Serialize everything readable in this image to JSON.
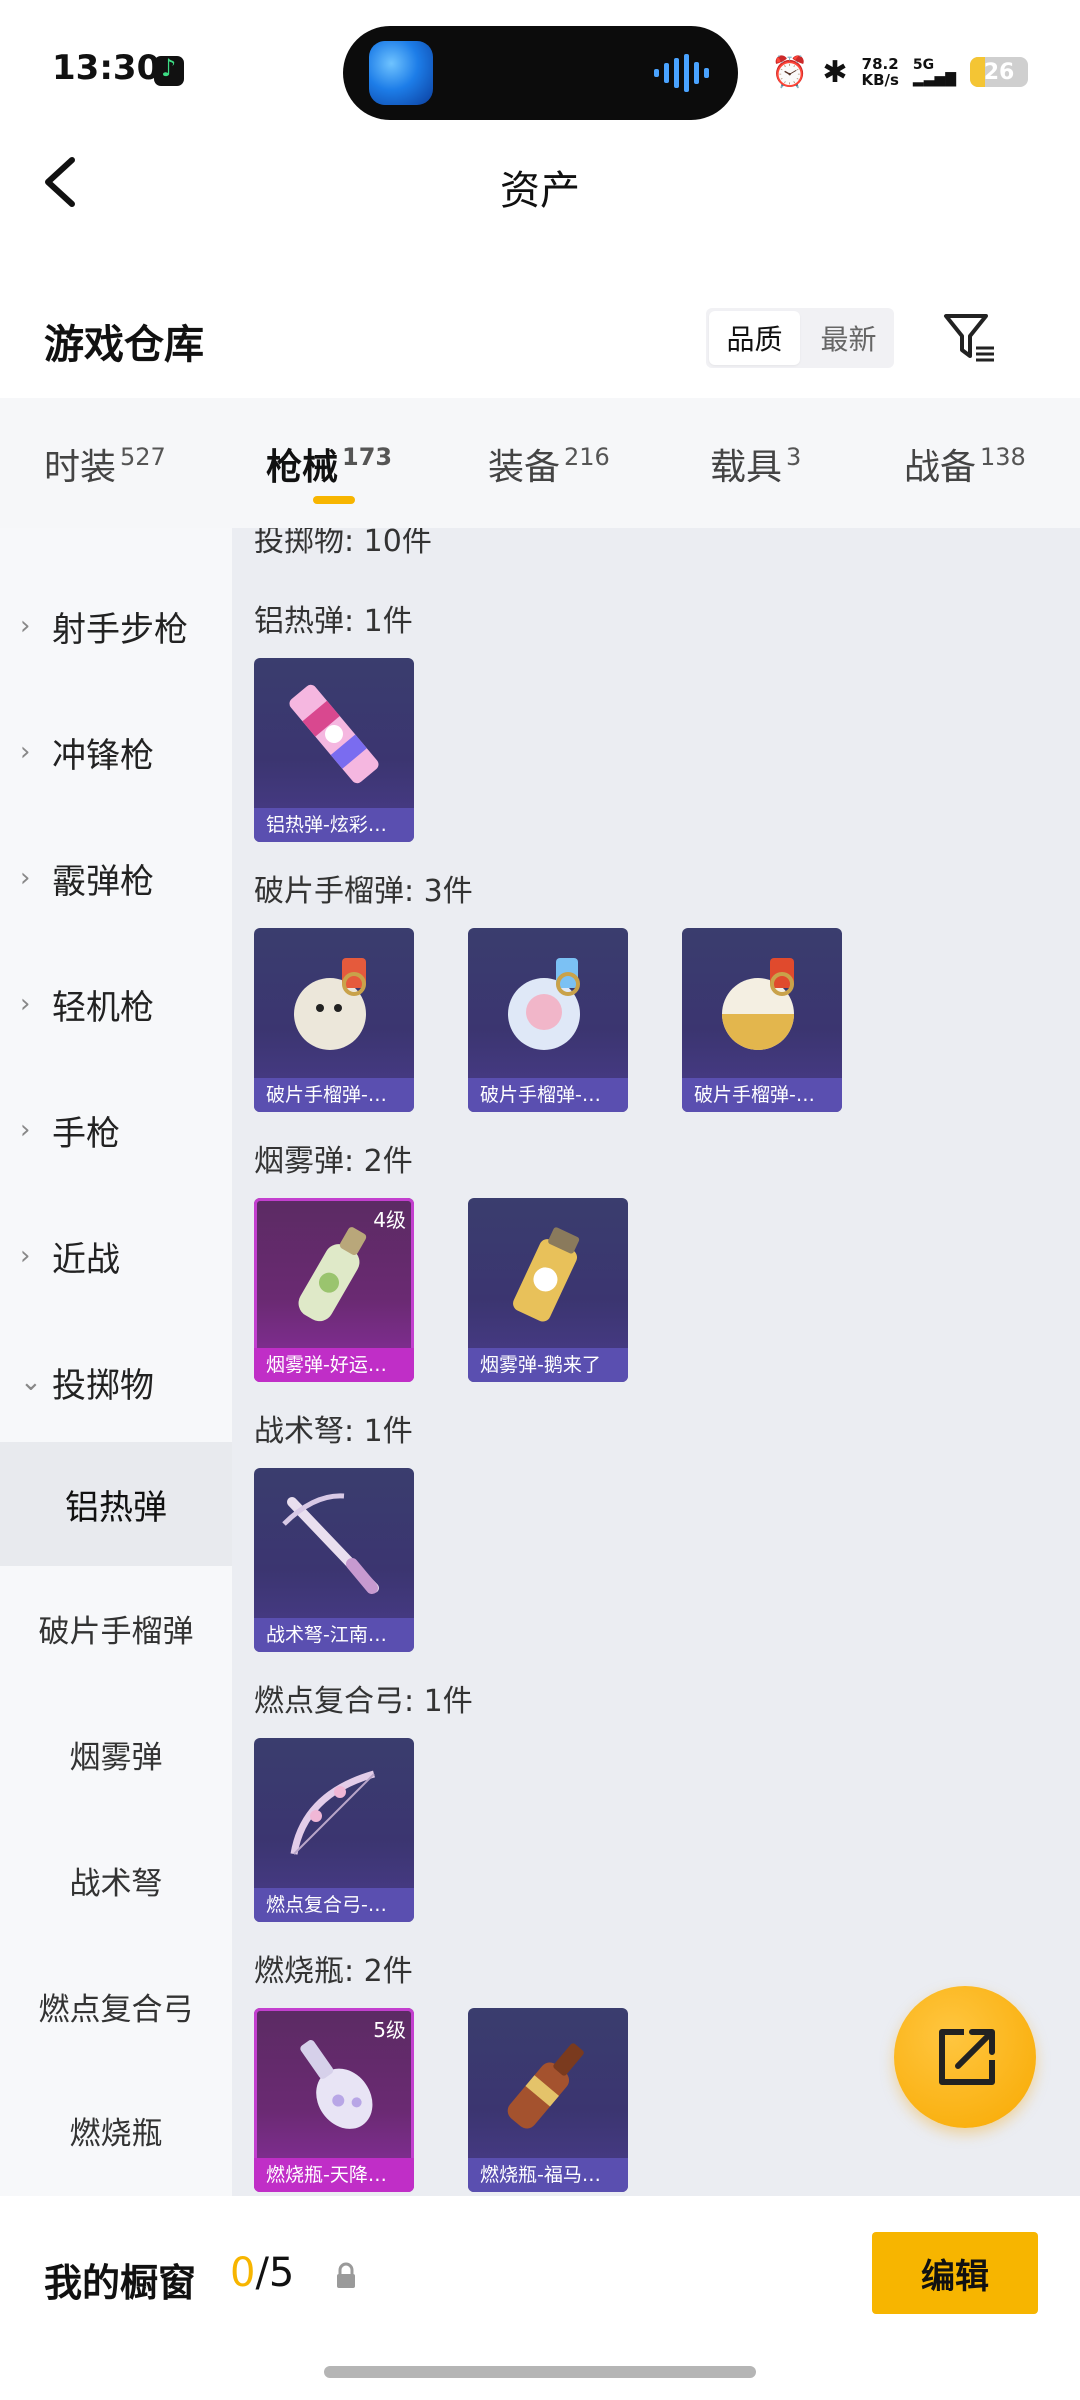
{
  "status_bar": {
    "time": "13:30",
    "net_speed_value": "78.2",
    "net_speed_unit": "KB/s",
    "network": "5G",
    "battery": "26"
  },
  "header": {
    "title": "资产",
    "back_icon": "chevron-left-icon"
  },
  "section": {
    "title": "游戏仓库",
    "sort_options": [
      "品质",
      "最新"
    ],
    "sort_active": "品质",
    "filter_icon": "filter-icon"
  },
  "tabs": [
    {
      "label": "时装",
      "count": "527"
    },
    {
      "label": "枪械",
      "count": "173",
      "active": true
    },
    {
      "label": "装备",
      "count": "216"
    },
    {
      "label": "载具",
      "count": "3"
    },
    {
      "label": "战备",
      "count": "138"
    }
  ],
  "sidebar": {
    "categories": [
      "射手步枪",
      "冲锋枪",
      "霰弹枪",
      "轻机枪",
      "手枪",
      "近战",
      "投掷物"
    ],
    "expanded": "投掷物",
    "subcategories": [
      "铝热弹",
      "破片手榴弹",
      "烟雾弹",
      "战术弩",
      "燃点复合弓",
      "燃烧瓶"
    ],
    "active_sub": "铝热弹"
  },
  "content": {
    "partial_header": "投掷物: 10件",
    "groups": [
      {
        "title": "铝热弹: 1件",
        "items": [
          {
            "name": "铝热弹-炫彩…",
            "rarity": "normal"
          }
        ]
      },
      {
        "title": "破片手榴弹: 3件",
        "items": [
          {
            "name": "破片手榴弹-…",
            "rarity": "normal"
          },
          {
            "name": "破片手榴弹-…",
            "rarity": "normal"
          },
          {
            "name": "破片手榴弹-…",
            "rarity": "normal"
          }
        ]
      },
      {
        "title": "烟雾弹: 2件",
        "items": [
          {
            "name": "烟雾弹-好运…",
            "rarity": "epic",
            "level": "4级"
          },
          {
            "name": "烟雾弹-鹅来了",
            "rarity": "normal"
          }
        ]
      },
      {
        "title": "战术弩: 1件",
        "items": [
          {
            "name": "战术弩-江南…",
            "rarity": "normal"
          }
        ]
      },
      {
        "title": "燃点复合弓: 1件",
        "items": [
          {
            "name": "燃点复合弓-…",
            "rarity": "normal"
          }
        ]
      },
      {
        "title": "燃烧瓶: 2件",
        "items": [
          {
            "name": "燃烧瓶-天降…",
            "rarity": "epic",
            "level": "5级"
          },
          {
            "name": "燃烧瓶-福马…",
            "rarity": "normal"
          }
        ]
      }
    ]
  },
  "fab": {
    "icon": "share-icon"
  },
  "bottom_bar": {
    "label": "我的橱窗",
    "used": "0",
    "total": "/5",
    "lock_icon": "lock-icon",
    "edit_label": "编辑"
  },
  "colors": {
    "accent": "#f7b500",
    "item_bg": "#3b3570",
    "epic_border": "#c33fcf"
  }
}
